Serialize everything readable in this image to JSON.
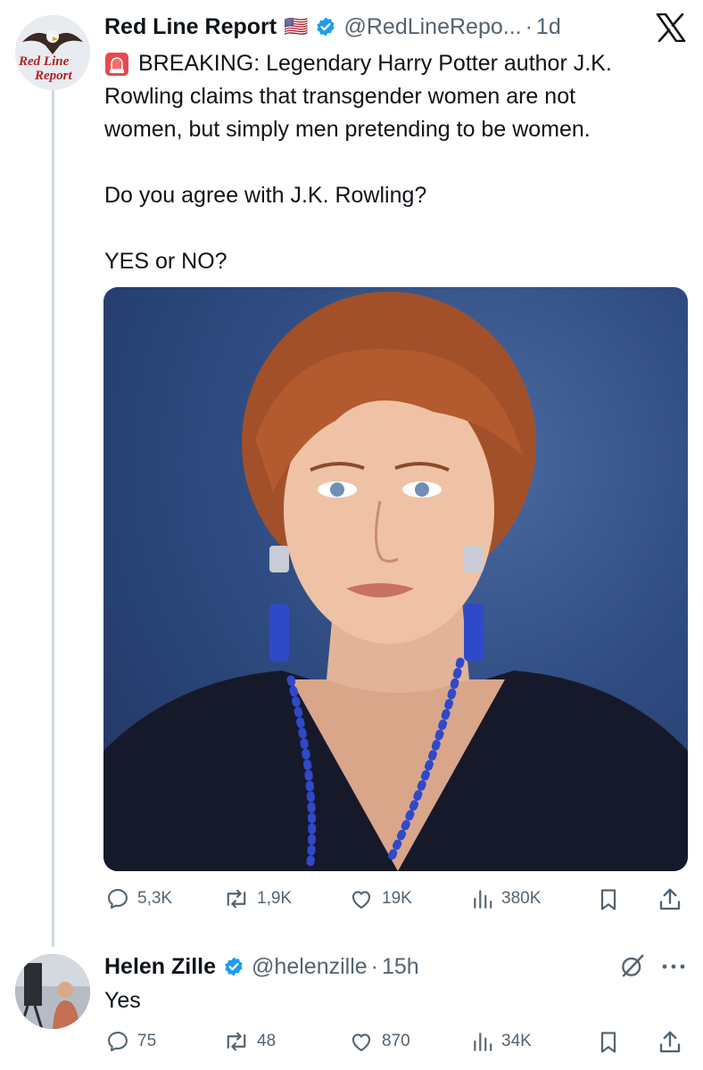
{
  "tweet": {
    "author_name": "Red Line Report",
    "flag": "🇺🇸",
    "handle": "@RedLineRepo...",
    "dot": "·",
    "time": "1d",
    "line1": "BREAKING: Legendary Harry Potter author J.K.",
    "line2": "Rowling claims that transgender women are not",
    "line3": "women, but simply men pretending to be women.",
    "line4": "Do you agree with J.K. Rowling?",
    "line5": "YES or NO?",
    "avatar_text_1": "Red Line",
    "avatar_text_2": "Report",
    "stats": {
      "replies": "5,3K",
      "reposts": "1,9K",
      "likes": "19K",
      "views": "380K"
    }
  },
  "reply": {
    "author_name": "Helen Zille",
    "handle": "@helenzille",
    "dot": "·",
    "time": "15h",
    "text": "Yes",
    "stats": {
      "replies": "75",
      "reposts": "48",
      "likes": "870",
      "views": "34K"
    }
  },
  "colors": {
    "verified": "#1d9bf0",
    "muted": "#536471",
    "thread_line": "#cfd9de",
    "photo_bg": "#2b4a7e"
  }
}
